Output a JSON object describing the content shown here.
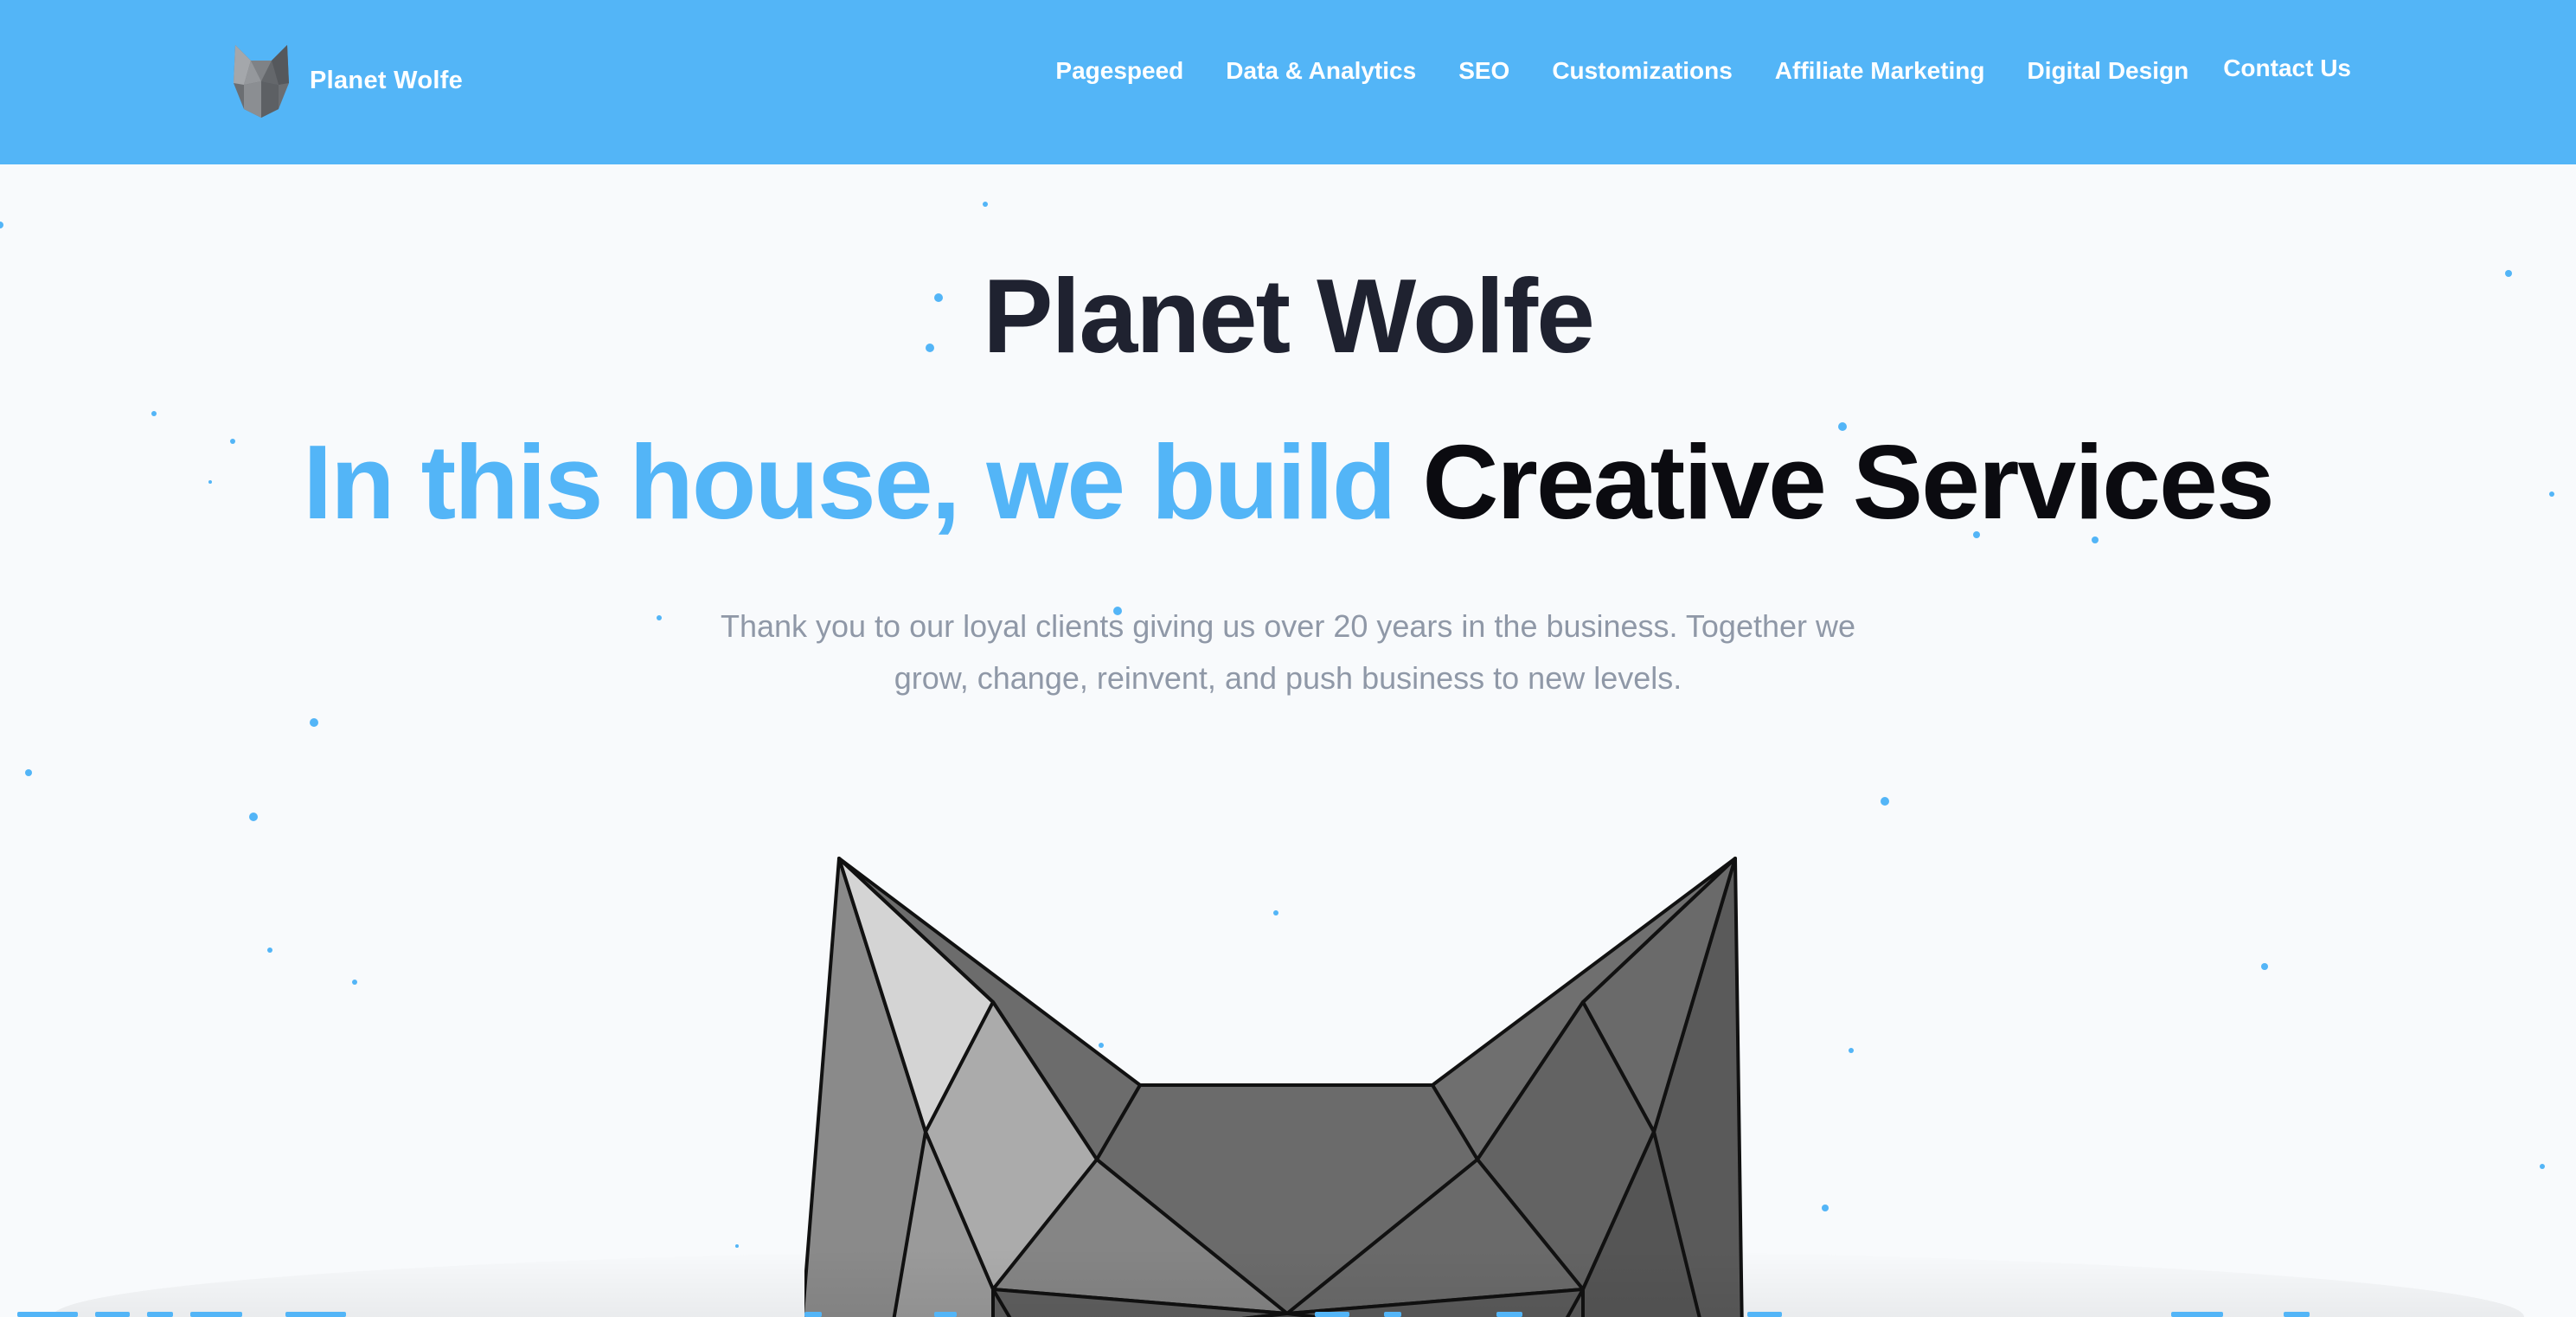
{
  "header": {
    "brand_name": "Planet Wolfe",
    "nav": [
      {
        "label": "Pagespeed"
      },
      {
        "label": "Data & Analytics"
      },
      {
        "label": "SEO"
      },
      {
        "label": "Customizations"
      },
      {
        "label": "Affiliate Marketing"
      },
      {
        "label": "Digital Design"
      },
      {
        "label": "Contact Us"
      }
    ]
  },
  "hero": {
    "title": "Planet Wolfe",
    "tagline_lead": "In this house, we build",
    "tagline_emphasis": "Creative Services",
    "subtitle_line1": "Thank you to our loyal clients giving us over 20 years in the business. Together we",
    "subtitle_line2": "grow, change, reinvent, and push business to new levels."
  },
  "colors": {
    "brand_blue": "#53b5f7",
    "heading_dark": "#1f2230",
    "subtitle_gray": "#8f98a7",
    "background": "#f8fafc"
  },
  "icons": {
    "logo": "wolf-head-icon",
    "hero_graphic": "low-poly-wolf-head"
  }
}
